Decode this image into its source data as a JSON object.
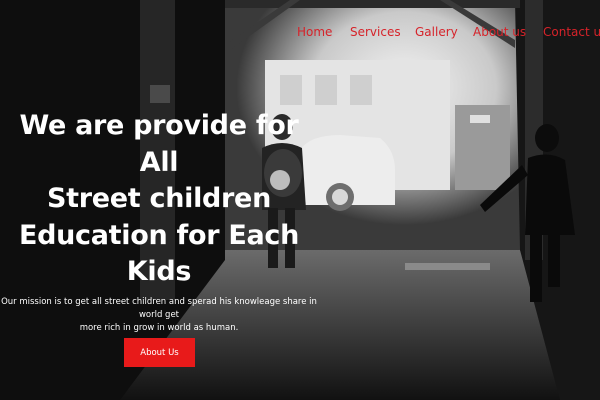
{
  "nav": {
    "items": [
      {
        "label": "Home"
      },
      {
        "label": "Services"
      },
      {
        "label": "Gallery"
      },
      {
        "label": "About us"
      },
      {
        "label": "Contact us"
      }
    ],
    "link_color": "#d6232a"
  },
  "hero": {
    "headline_lines": [
      "We are provide for",
      "All",
      "Street children",
      "Education for Each",
      "Kids"
    ],
    "mission_line_1": "Our mission is to get all street children and sperad his knowleage share in world get",
    "mission_line_2": "more rich in grow in world as human.",
    "cta_label": "About Us",
    "cta_color": "#e81a1a"
  }
}
